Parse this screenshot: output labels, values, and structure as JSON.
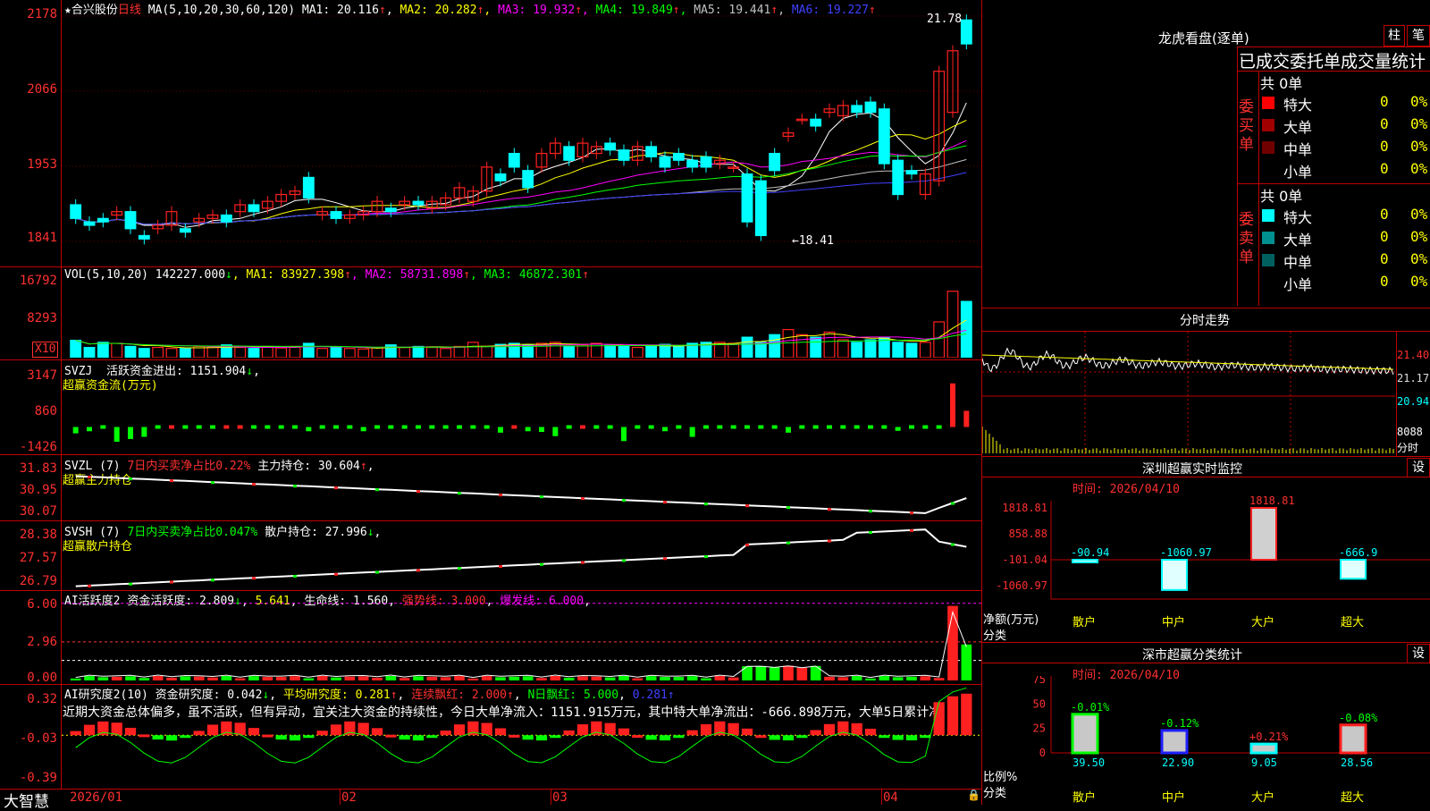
{
  "colors": {
    "up": "#ff2020",
    "down": "#00ffff",
    "vol_down": "#00ffff",
    "bg": "#000000",
    "frame": "#c00000"
  },
  "kline": {
    "stock_name": "合兴股份",
    "star": "★",
    "period": "日线",
    "ma_label": "MA(5,10,20,30,60,120)",
    "ma": [
      {
        "name": "MA1",
        "value": "20.116",
        "arrow": "↑",
        "color": "#ffffff"
      },
      {
        "name": "MA2",
        "value": "20.282",
        "arrow": "↑",
        "color": "#ffff00"
      },
      {
        "name": "MA3",
        "value": "19.932",
        "arrow": "↑",
        "color": "#ff00ff"
      },
      {
        "name": "MA4",
        "value": "19.849",
        "arrow": "↑",
        "color": "#00ff00"
      },
      {
        "name": "MA5",
        "value": "19.441",
        "arrow": "↑",
        "color": "#c0c0c0"
      },
      {
        "name": "MA6",
        "value": "19.227",
        "arrow": "↑",
        "color": "#4040ff"
      }
    ],
    "y_labels": [
      "2178",
      "2066",
      "1953",
      "1841"
    ],
    "high_mark": "21.78",
    "low_mark": "←18.41"
  },
  "vol": {
    "label": "VOL(5,10,20)",
    "value": "142227.000",
    "arrow": "↓",
    "ma": [
      {
        "name": "MA1",
        "value": "83927.398",
        "arrow": "↑",
        "color": "#ffff00"
      },
      {
        "name": "MA2",
        "value": "58731.898",
        "arrow": "↑",
        "color": "#ff00ff"
      },
      {
        "name": "MA3",
        "value": "46872.301",
        "arrow": "↑",
        "color": "#00ff00"
      }
    ],
    "y_labels": [
      "16792",
      "8293"
    ],
    "unit": "X10"
  },
  "svzj": {
    "label": "SVZJ",
    "title": "活跃资金进出:",
    "value": "1151.904",
    "arrow": "↓",
    "subtitle": "超赢资金流(万元)",
    "y_labels": [
      "3147",
      "860",
      "-1426"
    ]
  },
  "svzl": {
    "label": "SVZL (7)",
    "ratio": "7日内买卖净占比0.22%",
    "title": "主力持仓:",
    "value": "30.604",
    "arrow": "↑",
    "subtitle": "超赢主力持仓",
    "y_labels": [
      "31.83",
      "30.95",
      "30.07"
    ]
  },
  "svsh": {
    "label": "SVSH (7)",
    "ratio": "7日内买卖净占比0.047%",
    "title": "散户持仓:",
    "value": "27.996",
    "arrow": "↓",
    "subtitle": "超赢散户持仓",
    "y_labels": [
      "28.38",
      "27.57",
      "26.79"
    ]
  },
  "ai_active": {
    "label": "AI活跃度2",
    "t1": "资金活跃度:",
    "v1": "2.809",
    "a1": "↓",
    "v2": "5.641",
    "t3": "生命线:",
    "v3": "1.560",
    "t4": "强势线:",
    "v4": "3.000",
    "t5": "爆发线:",
    "v5": "6.000",
    "y_labels": [
      "6.00",
      "2.96",
      "0.00"
    ]
  },
  "ai_research": {
    "label": "AI研究度2(10)",
    "t1": "资金研究度:",
    "v1": "0.042",
    "a1": "↓",
    "t2": "平均研究度:",
    "v2": "0.281",
    "a2": "↑",
    "t3": "连续飘红:",
    "v3": "2.000",
    "a3": "↑",
    "t4": "N日飘红:",
    "v4": "5.000",
    "v5": "0.281",
    "a5": "↑",
    "comment": "近期大资金总体偏多，虽不活跃，但有异动，宜关注大资金的持续性，今日大单净流入：1151.915万元，其中特大单净流出：-666.898万元，大单5日累计净",
    "y_labels": [
      "0.32",
      "-0.03",
      "-0.39"
    ]
  },
  "x_axis": {
    "brand": "大智慧",
    "dates": [
      "2026/01",
      "02",
      "03",
      "04"
    ]
  },
  "right": {
    "lhb_title": "龙虎看盘(逐单)",
    "btn_zhu": "柱",
    "btn_bi": "笔",
    "tabs": [
      "已成交",
      "委托单",
      "成交量统计"
    ],
    "buy": {
      "side": "委买单",
      "total": "共 0单",
      "rows": [
        {
          "name": "特大",
          "count": "0",
          "pct": "0%",
          "color": "#ff0000"
        },
        {
          "name": "大单",
          "count": "0",
          "pct": "0%",
          "color": "#a00000"
        },
        {
          "name": "中单",
          "count": "0",
          "pct": "0%",
          "color": "#700000"
        },
        {
          "name": "小单",
          "count": "0",
          "pct": "0%",
          "color": "#000000"
        }
      ]
    },
    "sell": {
      "side": "委卖单",
      "total": "共 0单",
      "rows": [
        {
          "name": "特大",
          "count": "0",
          "pct": "0%",
          "color": "#00ffff"
        },
        {
          "name": "大单",
          "count": "0",
          "pct": "0%",
          "color": "#009090"
        },
        {
          "name": "中单",
          "count": "0",
          "pct": "0%",
          "color": "#006060"
        },
        {
          "name": "小单",
          "count": "0",
          "pct": "0%",
          "color": "#000000"
        }
      ]
    },
    "fenshi": {
      "title": "分时走势",
      "y_labels": [
        "21.40",
        "21.17",
        "20.94"
      ],
      "vol_label": "8088",
      "vol_unit": "分时"
    },
    "sz_monitor": {
      "title": "深圳超赢实时监控",
      "btn": "设",
      "time": "时间: 2026/04/10",
      "y_labels": [
        "1818.81",
        "858.88",
        "-101.04",
        "-1060.97"
      ],
      "ylabel": "净额(万元)",
      "xlabel": "分类",
      "categories": [
        "散户",
        "中户",
        "大户",
        "超大"
      ],
      "values": [
        -90.94,
        -1060.97,
        1818.81,
        -666.9
      ],
      "value_labels": [
        "-90.94",
        "-1060.97",
        "1818.81",
        "-666.9"
      ]
    },
    "sz_class": {
      "title": "深市超赢分类统计",
      "btn": "设",
      "time": "时间: 2026/04/10",
      "y_labels": [
        "75",
        "50",
        "25",
        "0"
      ],
      "ylabel": "比例%",
      "xlabel": "分类",
      "categories": [
        "散户",
        "中户",
        "大户",
        "超大"
      ],
      "values": [
        39.5,
        22.9,
        9.05,
        28.56
      ],
      "change_labels": [
        "-0.01%",
        "-0.12%",
        "+0.21%",
        "-0.08%"
      ],
      "value_labels": [
        "39.50",
        "22.90",
        "9.05",
        "28.56"
      ]
    }
  },
  "chart_data": [
    {
      "type": "candlestick",
      "title": "合兴股份 日线",
      "ylim": [
        18.41,
        21.78
      ],
      "open": [
        19.05,
        18.8,
        18.85,
        18.9,
        18.95,
        18.6,
        18.7,
        18.75,
        18.7,
        18.8,
        18.85,
        18.9,
        18.95,
        19.05,
        19.0,
        19.1,
        19.2,
        19.45,
        18.9,
        18.95,
        18.85,
        18.9,
        18.95,
        19.0,
        19.05,
        19.1,
        19.0,
        19.05,
        19.15,
        19.1,
        19.25,
        19.5,
        19.8,
        19.55,
        19.6,
        19.8,
        19.9,
        19.75,
        19.8,
        19.95,
        19.85,
        19.7,
        19.9,
        19.75,
        19.8,
        19.7,
        19.75,
        19.65,
        19.6,
        19.5,
        19.4,
        19.8,
        20.05,
        20.3,
        20.3,
        20.4,
        20.35,
        20.5,
        20.55,
        20.45,
        19.7,
        19.55,
        19.2,
        19.4,
        20.4,
        21.75
      ],
      "close": [
        18.85,
        18.75,
        18.8,
        18.95,
        18.7,
        18.55,
        18.75,
        18.95,
        18.65,
        18.85,
        18.9,
        18.8,
        19.05,
        18.95,
        19.1,
        19.2,
        19.25,
        19.15,
        18.95,
        18.85,
        18.9,
        18.95,
        19.1,
        18.95,
        19.1,
        19.05,
        19.1,
        19.15,
        19.3,
        19.25,
        19.6,
        19.4,
        19.6,
        19.3,
        19.8,
        19.95,
        19.7,
        19.95,
        19.9,
        19.85,
        19.7,
        19.9,
        19.75,
        19.6,
        19.7,
        19.6,
        19.6,
        19.7,
        19.6,
        18.8,
        18.6,
        19.55,
        20.1,
        20.3,
        20.2,
        20.45,
        20.5,
        20.4,
        20.4,
        19.65,
        19.2,
        19.5,
        19.5,
        21.0,
        21.3,
        21.4
      ],
      "volume": [
        34,
        20,
        30,
        28,
        22,
        18,
        20,
        18,
        18,
        22,
        20,
        25,
        20,
        18,
        22,
        19,
        22,
        28,
        18,
        20,
        18,
        17,
        20,
        25,
        20,
        22,
        20,
        18,
        22,
        30,
        22,
        26,
        28,
        25,
        28,
        30,
        22,
        25,
        28,
        24,
        22,
        20,
        24,
        26,
        22,
        28,
        30,
        30,
        28,
        40,
        30,
        45,
        55,
        45,
        40,
        50,
        35,
        30,
        35,
        40,
        30,
        28,
        30,
        70,
        130,
        110
      ]
    },
    {
      "type": "bar",
      "title": "超赢资金流(万元)",
      "ylim": [
        -1426,
        3147
      ],
      "values": [
        -450,
        -300,
        -120,
        -1050,
        -850,
        -700,
        -230,
        100,
        -100,
        -150,
        -100,
        60,
        80,
        -120,
        -100,
        -70,
        -80,
        -300,
        -120,
        -60,
        -70,
        -300,
        -250,
        -60,
        -80,
        -70,
        -120,
        -60,
        -70,
        -200,
        -50,
        -400,
        150,
        -300,
        -350,
        -650,
        -200,
        80,
        -50,
        -50,
        -1000,
        -100,
        -60,
        -300,
        -200,
        -700,
        -110,
        -70,
        -200,
        -80,
        -150,
        -200,
        -400,
        -150,
        -160,
        -140,
        -150,
        -230,
        -250,
        -250,
        -270,
        -200,
        -180,
        -200,
        3100,
        1150
      ]
    }
  ]
}
